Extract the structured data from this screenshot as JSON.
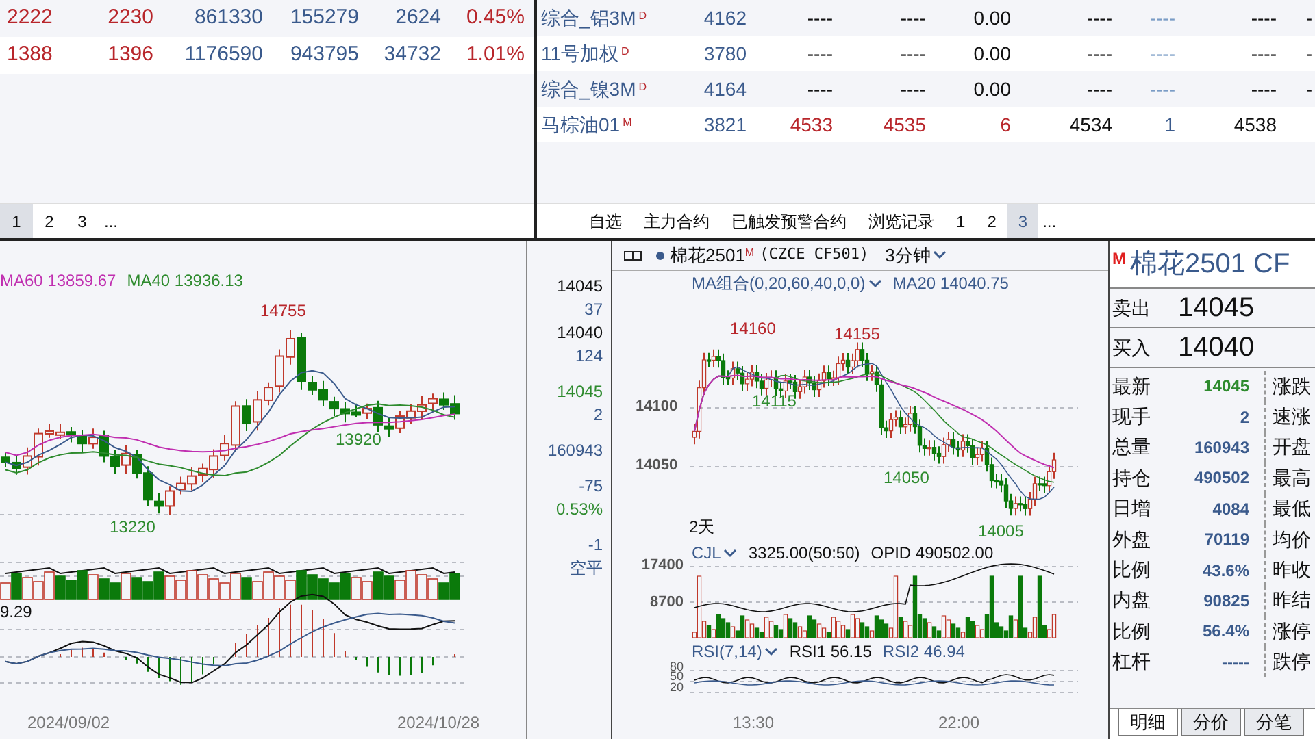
{
  "quote_list_left": {
    "rows": [
      {
        "cells": [
          {
            "text": "2222",
            "color": "#b8262b"
          },
          {
            "text": "2230",
            "color": "#b8262b"
          },
          {
            "text": "861330",
            "color": "#3a5a8c"
          },
          {
            "text": "155279",
            "color": "#3a5a8c"
          },
          {
            "text": "2624",
            "color": "#3a5a8c"
          },
          {
            "text": "0.45%",
            "color": "#b8262b"
          }
        ]
      },
      {
        "cells": [
          {
            "text": "1388",
            "color": "#b8262b"
          },
          {
            "text": "1396",
            "color": "#b8262b"
          },
          {
            "text": "1176590",
            "color": "#3a5a8c"
          },
          {
            "text": "943795",
            "color": "#3a5a8c"
          },
          {
            "text": "34732",
            "color": "#3a5a8c"
          },
          {
            "text": "1.01%",
            "color": "#b8262b"
          }
        ]
      }
    ],
    "pages": [
      {
        "label": "1",
        "selected": true
      },
      {
        "label": "2",
        "selected": false
      },
      {
        "label": "3",
        "selected": false
      }
    ],
    "more": "..."
  },
  "quote_list_right": {
    "rows": [
      {
        "name": "综合_铝3M",
        "flag": "D",
        "cells": [
          {
            "text": "4162",
            "color": "#3a5a8c"
          },
          {
            "text": "----",
            "color": "#111111"
          },
          {
            "text": "----",
            "color": "#111111"
          },
          {
            "text": "0.00",
            "color": "#111111"
          },
          {
            "text": "----",
            "color": "#111111"
          },
          {
            "text": "----",
            "color": "#7a9cc6"
          },
          {
            "text": "----",
            "color": "#111111"
          },
          {
            "text": "-",
            "color": "#111111"
          }
        ]
      },
      {
        "name": "11号加权",
        "flag": "D",
        "cells": [
          {
            "text": "3780",
            "color": "#3a5a8c"
          },
          {
            "text": "----",
            "color": "#111111"
          },
          {
            "text": "----",
            "color": "#111111"
          },
          {
            "text": "0.00",
            "color": "#111111"
          },
          {
            "text": "----",
            "color": "#111111"
          },
          {
            "text": "----",
            "color": "#7a9cc6"
          },
          {
            "text": "----",
            "color": "#111111"
          },
          {
            "text": "-",
            "color": "#111111"
          }
        ]
      },
      {
        "name": "综合_镍3M",
        "flag": "D",
        "cells": [
          {
            "text": "4164",
            "color": "#3a5a8c"
          },
          {
            "text": "----",
            "color": "#111111"
          },
          {
            "text": "----",
            "color": "#111111"
          },
          {
            "text": "0.00",
            "color": "#111111"
          },
          {
            "text": "----",
            "color": "#111111"
          },
          {
            "text": "----",
            "color": "#7a9cc6"
          },
          {
            "text": "----",
            "color": "#111111"
          },
          {
            "text": "-",
            "color": "#111111"
          }
        ]
      },
      {
        "name": "马棕油01",
        "flag": "M",
        "cells": [
          {
            "text": "3821",
            "color": "#3a5a8c"
          },
          {
            "text": "4533",
            "color": "#b8262b"
          },
          {
            "text": "4535",
            "color": "#b8262b"
          },
          {
            "text": "6",
            "color": "#b8262b"
          },
          {
            "text": "4534",
            "color": "#111111"
          },
          {
            "text": "1",
            "color": "#3a5a8c"
          },
          {
            "text": "4538",
            "color": "#111111"
          }
        ]
      }
    ],
    "tabs": [
      {
        "label": "自选",
        "selected": false
      },
      {
        "label": "主力合约",
        "selected": false
      },
      {
        "label": "已触发预警合约",
        "selected": false
      },
      {
        "label": "浏览记录",
        "selected": false
      },
      {
        "label": "1",
        "selected": false
      },
      {
        "label": "2",
        "selected": false
      },
      {
        "label": "3",
        "selected": true
      }
    ],
    "more": "..."
  },
  "daily_chart": {
    "ma_values": [
      {
        "text": "MA60 13859.67",
        "color": "#c02fb0"
      },
      {
        "text": "MA40 13936.13",
        "color": "#2e8b2e"
      }
    ],
    "price_marks": [
      {
        "text": "14755",
        "color": "#b8262b"
      },
      {
        "text": "13920",
        "color": "#2e8b2e"
      },
      {
        "text": "13220",
        "color": "#2e8b2e"
      }
    ],
    "macd_value": "9.29",
    "x_ticks": [
      "2024/09/02",
      "2024/10/28"
    ]
  },
  "axis_readouts": [
    {
      "text": "14045",
      "color": "#111111"
    },
    {
      "text": "37",
      "color": "#3a5a8c"
    },
    {
      "text": "14040",
      "color": "#111111"
    },
    {
      "text": "124",
      "color": "#3a5a8c"
    },
    {
      "text": "14045",
      "color": "#2e8b2e"
    },
    {
      "text": "2",
      "color": "#3a5a8c"
    },
    {
      "text": "160943",
      "color": "#3a5a8c"
    },
    {
      "text": "-75",
      "color": "#3a5a8c"
    },
    {
      "text": "0.53%",
      "color": "#2e8b2e"
    },
    {
      "text": "-1",
      "color": "#3a5a8c"
    },
    {
      "text": "空平",
      "color": "#3a5a8c"
    }
  ],
  "intraday_chart": {
    "symbol": "棉花2501",
    "symbol_flag": "M",
    "exchange_code": "(CZCE CF501)",
    "period": "3分钟",
    "ma_setting": "MA组合(0,20,60,40,0,0)",
    "ma_value": "MA20 14040.75",
    "price_marks": [
      {
        "text": "14160",
        "color": "#b8262b"
      },
      {
        "text": "14155",
        "color": "#b8262b"
      },
      {
        "text": "14115",
        "color": "#2e8b2e"
      },
      {
        "text": "14050",
        "color": "#2e8b2e"
      },
      {
        "text": "14005",
        "color": "#2e8b2e"
      }
    ],
    "y_ticks": [
      "14100",
      "14050"
    ],
    "range_label": "2天",
    "volume": {
      "indicator": "CJL",
      "value": "3325.00(50:50)",
      "opid": "OPID 490502.00",
      "y_ticks": [
        "17400",
        "8700"
      ]
    },
    "rsi": {
      "indicator": "RSI(7,14)",
      "rsi1": "RSI1 56.15",
      "rsi2": "RSI2 46.94",
      "y_ticks": [
        "80",
        "50",
        "20"
      ]
    },
    "x_ticks": [
      "13:30",
      "22:00"
    ]
  },
  "quote_panel": {
    "flag": "M",
    "title": "棉花2501 CF",
    "ask": {
      "label": "卖出",
      "value": "14045"
    },
    "bid": {
      "label": "买入",
      "value": "14040"
    },
    "stats": [
      {
        "label": "最新",
        "value": "14045",
        "color": "#2e8b2e",
        "right_label": "涨跌"
      },
      {
        "label": "现手",
        "value": "2",
        "color": "#3a5a8c",
        "right_label": "速涨"
      },
      {
        "label": "总量",
        "value": "160943",
        "color": "#3a5a8c",
        "right_label": "开盘"
      },
      {
        "label": "持仓",
        "value": "490502",
        "color": "#3a5a8c",
        "right_label": "最高"
      },
      {
        "label": "日增",
        "value": "4084",
        "color": "#3a5a8c",
        "right_label": "最低"
      },
      {
        "label": "外盘",
        "value": "70119",
        "color": "#3a5a8c",
        "right_label": "均价"
      },
      {
        "label": "比例",
        "value": "43.6%",
        "color": "#3a5a8c",
        "right_label": "昨收"
      },
      {
        "label": "内盘",
        "value": "90825",
        "color": "#3a5a8c",
        "right_label": "昨结"
      },
      {
        "label": "比例",
        "value": "56.4%",
        "color": "#3a5a8c",
        "right_label": "涨停"
      },
      {
        "label": "杠杆",
        "value": "-----",
        "color": "#3a5a8c",
        "right_label": "跌停"
      }
    ],
    "tabs": [
      {
        "label": "明细",
        "selected": true
      },
      {
        "label": "分价",
        "selected": false
      },
      {
        "label": "分笔",
        "selected": false
      }
    ]
  }
}
